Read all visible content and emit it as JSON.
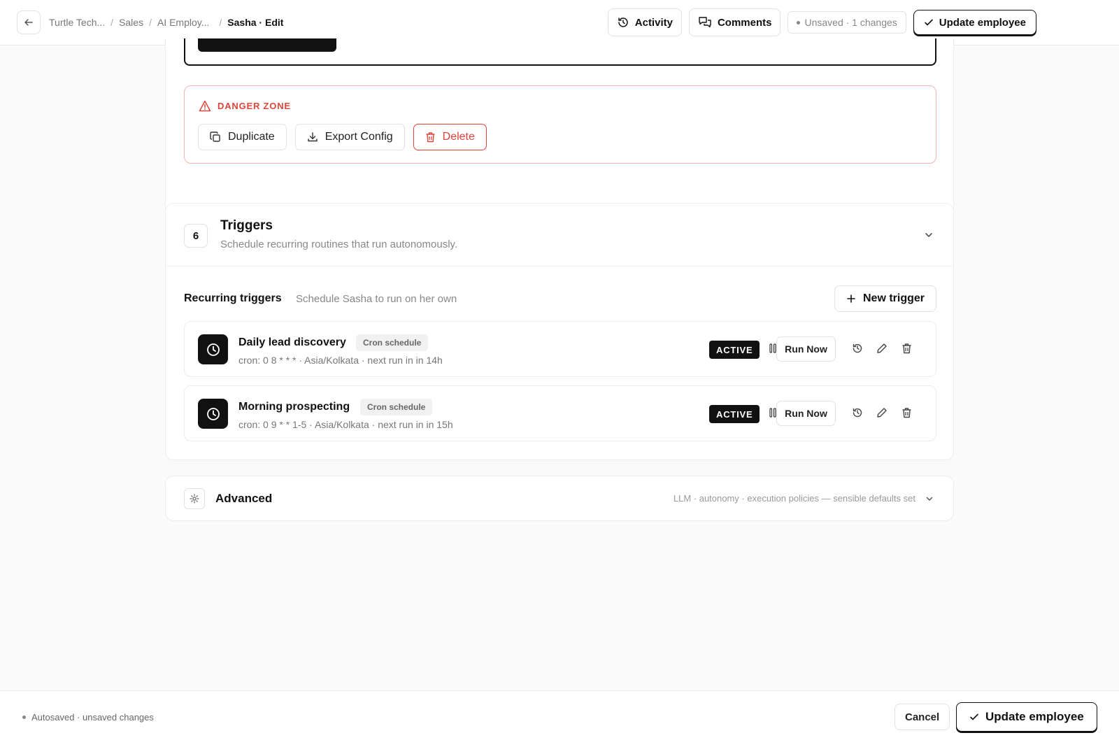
{
  "header": {
    "breadcrumb": [
      "Turtle Tech...",
      "Sales",
      "AI Employ...",
      "Sasha · Edit"
    ],
    "breadcrumb_sep": "/",
    "activity_label": "Activity",
    "comments_label": "Comments",
    "unsaved_label": "Unsaved · 1 changes",
    "update_label": "Update employee"
  },
  "danger_zone": {
    "title": "DANGER ZONE",
    "duplicate_label": "Duplicate",
    "export_label": "Export Config",
    "delete_label": "Delete"
  },
  "triggers_section": {
    "number": "6",
    "title": "Triggers",
    "subtitle": "Schedule recurring routines that run autonomously.",
    "recurring_label": "Recurring triggers",
    "recurring_sub": "Schedule Sasha to run on her own",
    "new_trigger_label": "New trigger",
    "items": [
      {
        "name": "Daily lead discovery",
        "type": "Cron schedule",
        "description": "cron: 0 8 * * * · Asia/Kolkata · next run in in 14h",
        "status": "ACTIVE",
        "run_label": "Run Now"
      },
      {
        "name": "Morning prospecting",
        "type": "Cron schedule",
        "description": "cron: 0 9 * * 1-5 · Asia/Kolkata · next run in in 15h",
        "status": "ACTIVE",
        "run_label": "Run Now"
      }
    ]
  },
  "advanced": {
    "title": "Advanced",
    "summary": "LLM · autonomy · execution policies — sensible defaults set"
  },
  "footer": {
    "autosave_label": "Autosaved · unsaved changes",
    "cancel_label": "Cancel",
    "update_label": "Update employee"
  },
  "colors": {
    "danger": "#e0453b",
    "danger_border": "#f2b4b0",
    "primary": "#111111"
  }
}
